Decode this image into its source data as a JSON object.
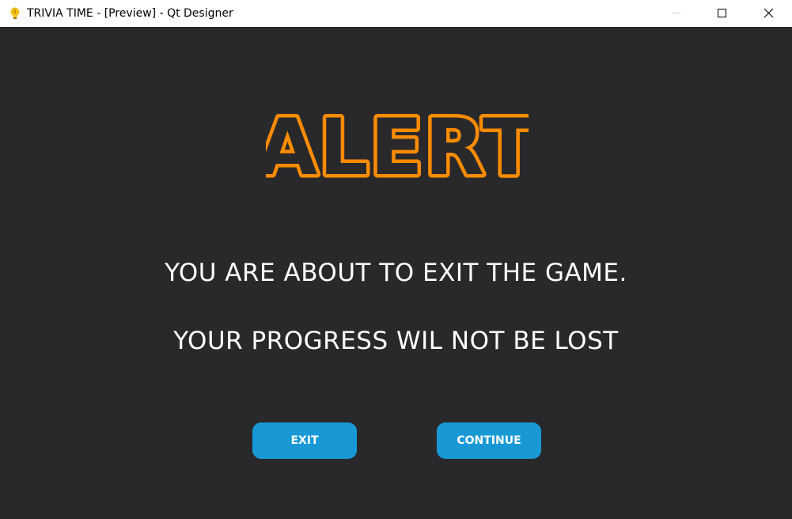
{
  "window": {
    "title": "TRIVIA TIME - [Preview] - Qt Designer",
    "icon": "lightbulb-icon",
    "controls": [
      "minimize-icon",
      "maximize-icon",
      "close-icon"
    ]
  },
  "dialog": {
    "heading": "ALERT",
    "messages": [
      "YOU ARE ABOUT TO EXIT THE GAME.",
      "YOUR PROGRESS WIL NOT BE LOST"
    ],
    "buttons": {
      "exit": "EXIT",
      "continue": "CONTINUE"
    }
  },
  "colors": {
    "background": "#29292b",
    "heading_fill": "#ff8c00",
    "heading_outline": "#ff8c00",
    "button": "#1899d6",
    "text": "#ffffff"
  }
}
